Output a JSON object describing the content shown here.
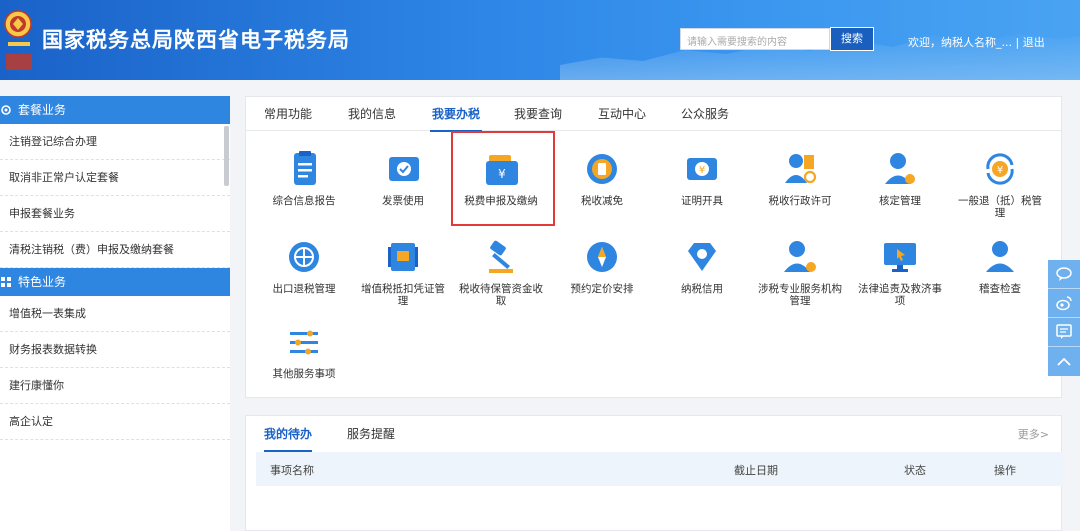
{
  "header": {
    "title": "国家税务总局陕西省电子税务局",
    "search_placeholder": "请输入需要搜索的内容",
    "search_button": "搜索",
    "welcome": "欢迎，纳税人名称_...",
    "separator": "|",
    "logout": "退出"
  },
  "sidebar": {
    "group1": "套餐业务",
    "group1_items": [
      "注销登记综合办理",
      "取消非正常户认定套餐",
      "申报套餐业务",
      "清税注销税（费）申报及缴纳套餐"
    ],
    "group2": "特色业务",
    "group2_items": [
      "增值税一表集成",
      "财务报表数据转换",
      "建行康懂你",
      "高企认定"
    ]
  },
  "main_tabs": [
    "常用功能",
    "我的信息",
    "我要办税",
    "我要查询",
    "互动中心",
    "公众服务"
  ],
  "active_tab": "我要办税",
  "functions": [
    {
      "label": "综合信息报告",
      "icon": "document-report-icon"
    },
    {
      "label": "发票使用",
      "icon": "invoice-icon"
    },
    {
      "label": "税费申报及缴纳",
      "icon": "tax-declare-wallet-icon"
    },
    {
      "label": "税收减免",
      "icon": "tax-relief-coin-icon"
    },
    {
      "label": "证明开具",
      "icon": "certificate-ticket-icon"
    },
    {
      "label": "税收行政许可",
      "icon": "admin-license-icon"
    },
    {
      "label": "核定管理",
      "icon": "verify-user-icon"
    },
    {
      "label": "一般退（抵）税管理",
      "icon": "refund-cycle-icon"
    },
    {
      "label": "出口退税管理",
      "icon": "export-globe-icon"
    },
    {
      "label": "增值税抵扣凭证管理",
      "icon": "vat-voucher-icon"
    },
    {
      "label": "税收待保管资金收取",
      "icon": "hammer-icon"
    },
    {
      "label": "预约定价安排",
      "icon": "compass-icon"
    },
    {
      "label": "纳税信用",
      "icon": "credit-diamond-icon"
    },
    {
      "label": "涉税专业服务机构管理",
      "icon": "agency-user-icon"
    },
    {
      "label": "法律追责及救济事项",
      "icon": "monitor-cursor-icon"
    },
    {
      "label": "稽查检查",
      "icon": "inspect-user-icon"
    },
    {
      "label": "其他服务事项",
      "icon": "sliders-icon"
    }
  ],
  "todo": {
    "tabs": [
      "我的待办",
      "服务提醒"
    ],
    "more": "更多>",
    "columns": [
      "事项名称",
      "截止日期",
      "状态",
      "操作"
    ]
  },
  "colors": {
    "accent": "#1a62c8",
    "sidebar_header": "#2f86e0",
    "highlight": "#e23a3a",
    "icon_blue": "#2f86e0",
    "icon_orange": "#f5a623"
  }
}
